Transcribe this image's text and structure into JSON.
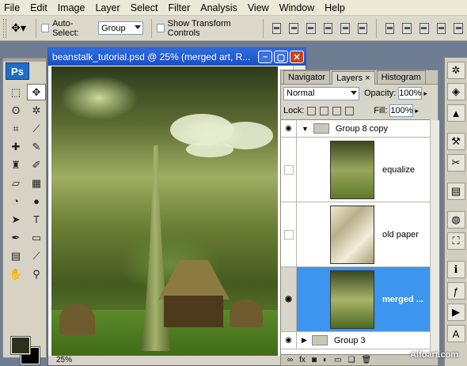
{
  "menu": [
    "File",
    "Edit",
    "Image",
    "Layer",
    "Select",
    "Filter",
    "Analysis",
    "View",
    "Window",
    "Help"
  ],
  "options": {
    "auto_select_label": "Auto-Select:",
    "auto_select_value": "Group",
    "show_transform_label": "Show Transform Controls"
  },
  "toolbox": {
    "logo": "Ps"
  },
  "document": {
    "title": "beanstalk_tutorial.psd @ 25% (merged art, R...",
    "zoom": "25%"
  },
  "layers_panel": {
    "tabs": [
      "Navigator",
      "Layers",
      "Histogram"
    ],
    "blend_mode": "Normal",
    "opacity_label": "Opacity:",
    "opacity_value": "100%",
    "lock_label": "Lock:",
    "fill_label": "Fill:",
    "fill_value": "100%",
    "layers": [
      {
        "name": "Group 8 copy",
        "type": "group",
        "expanded": true,
        "visible": true
      },
      {
        "name": "equalize",
        "type": "layer",
        "visible": false
      },
      {
        "name": "old paper",
        "type": "layer",
        "visible": false
      },
      {
        "name": "merged ...",
        "type": "layer",
        "visible": true,
        "selected": true
      },
      {
        "name": "Group 3",
        "type": "group",
        "expanded": false,
        "visible": true
      }
    ]
  },
  "watermark": "Alfoart.com",
  "colors": {
    "title_bar": "#2f6be0",
    "selection": "#3d95ee",
    "foreground": "#2c3219",
    "background": "#000000"
  }
}
